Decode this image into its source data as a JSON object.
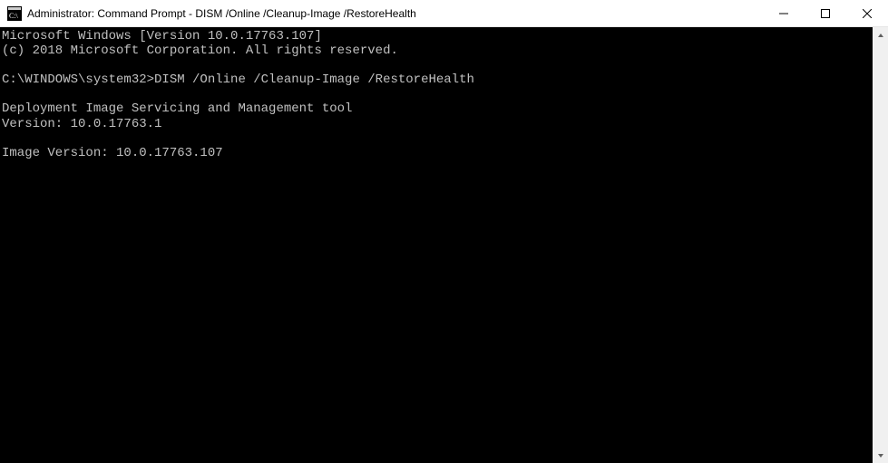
{
  "titlebar": {
    "title": "Administrator: Command Prompt - DISM  /Online /Cleanup-Image /RestoreHealth"
  },
  "terminal": {
    "lines": [
      "Microsoft Windows [Version 10.0.17763.107]",
      "(c) 2018 Microsoft Corporation. All rights reserved.",
      "",
      "C:\\WINDOWS\\system32>DISM /Online /Cleanup-Image /RestoreHealth",
      "",
      "Deployment Image Servicing and Management tool",
      "Version: 10.0.17763.1",
      "",
      "Image Version: 10.0.17763.107",
      ""
    ]
  }
}
